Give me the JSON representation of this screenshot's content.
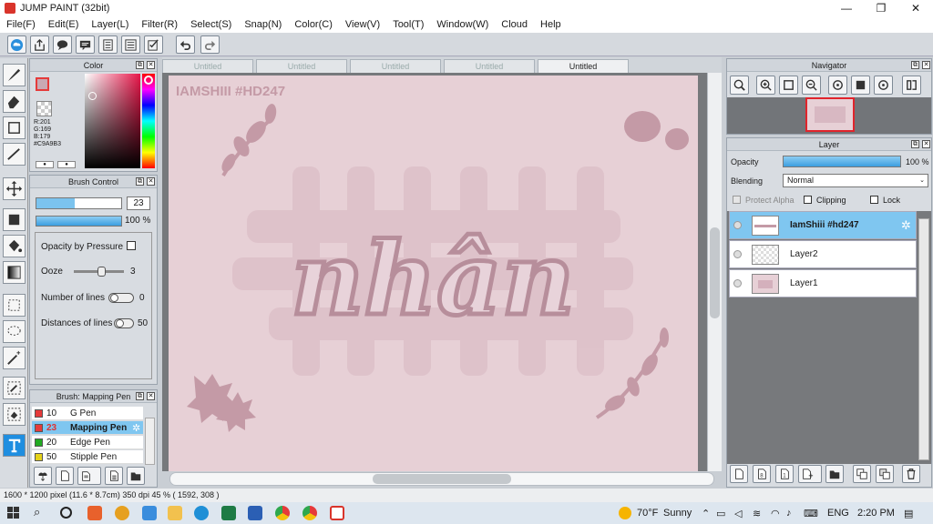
{
  "window": {
    "title": "JUMP PAINT (32bit)",
    "min": "—",
    "max": "❐",
    "close": "✕"
  },
  "menu": [
    "File(F)",
    "Edit(E)",
    "Layer(L)",
    "Filter(R)",
    "Select(S)",
    "Snap(N)",
    "Color(C)",
    "View(V)",
    "Tool(T)",
    "Window(W)",
    "Cloud",
    "Help"
  ],
  "color_panel": {
    "title": "Color",
    "r": "R:201",
    "g": "G:169",
    "b": "B:179",
    "hex": "#C9A9B3",
    "fg_color": "#C9A9B3",
    "accent": "#e53a3a"
  },
  "brush_control": {
    "title": "Brush Control",
    "size_value": "23",
    "opacity_value": "100 %",
    "opacity_by_pressure": "Opacity by Pressure",
    "ooze_label": "Ooze",
    "ooze_value": "3",
    "lines_label": "Number of lines",
    "lines_value": "0",
    "dist_label": "Distances of lines",
    "dist_value": "50"
  },
  "brush_list": {
    "title": "Brush: Mapping Pen",
    "items": [
      {
        "size": "10",
        "name": "G Pen",
        "color": "#e53a3a"
      },
      {
        "size": "23",
        "name": "Mapping Pen",
        "color": "#e53a3a"
      },
      {
        "size": "20",
        "name": "Edge Pen",
        "color": "#22aa22"
      },
      {
        "size": "50",
        "name": "Stipple Pen",
        "color": "#e5d21a"
      }
    ]
  },
  "tabs": [
    "Untitled",
    "Untitled",
    "Untitled",
    "Untitled",
    "Untitled"
  ],
  "artwork": {
    "watermark": "IAMSHIII #HD247",
    "main_text": "nhân",
    "bg_color": "#e7d0d6",
    "ink_color": "#c49aa6"
  },
  "navigator": {
    "title": "Navigator"
  },
  "layer_panel": {
    "title": "Layer",
    "opacity_label": "Opacity",
    "opacity_value": "100 %",
    "blending_label": "Blending",
    "blending_value": "Normal",
    "protect_alpha": "Protect Alpha",
    "clipping": "Clipping",
    "lock": "Lock",
    "layers": [
      {
        "name": "IamShiii #hd247"
      },
      {
        "name": "Layer2"
      },
      {
        "name": "Layer1"
      }
    ]
  },
  "status": "1600 * 1200 pixel   (11.6 * 8.7cm)   350 dpi   45 %   ( 1592, 308 )",
  "taskbar": {
    "weather_temp": "70°F",
    "weather_text": "Sunny",
    "lang": "ENG",
    "time": "2:20 PM"
  }
}
